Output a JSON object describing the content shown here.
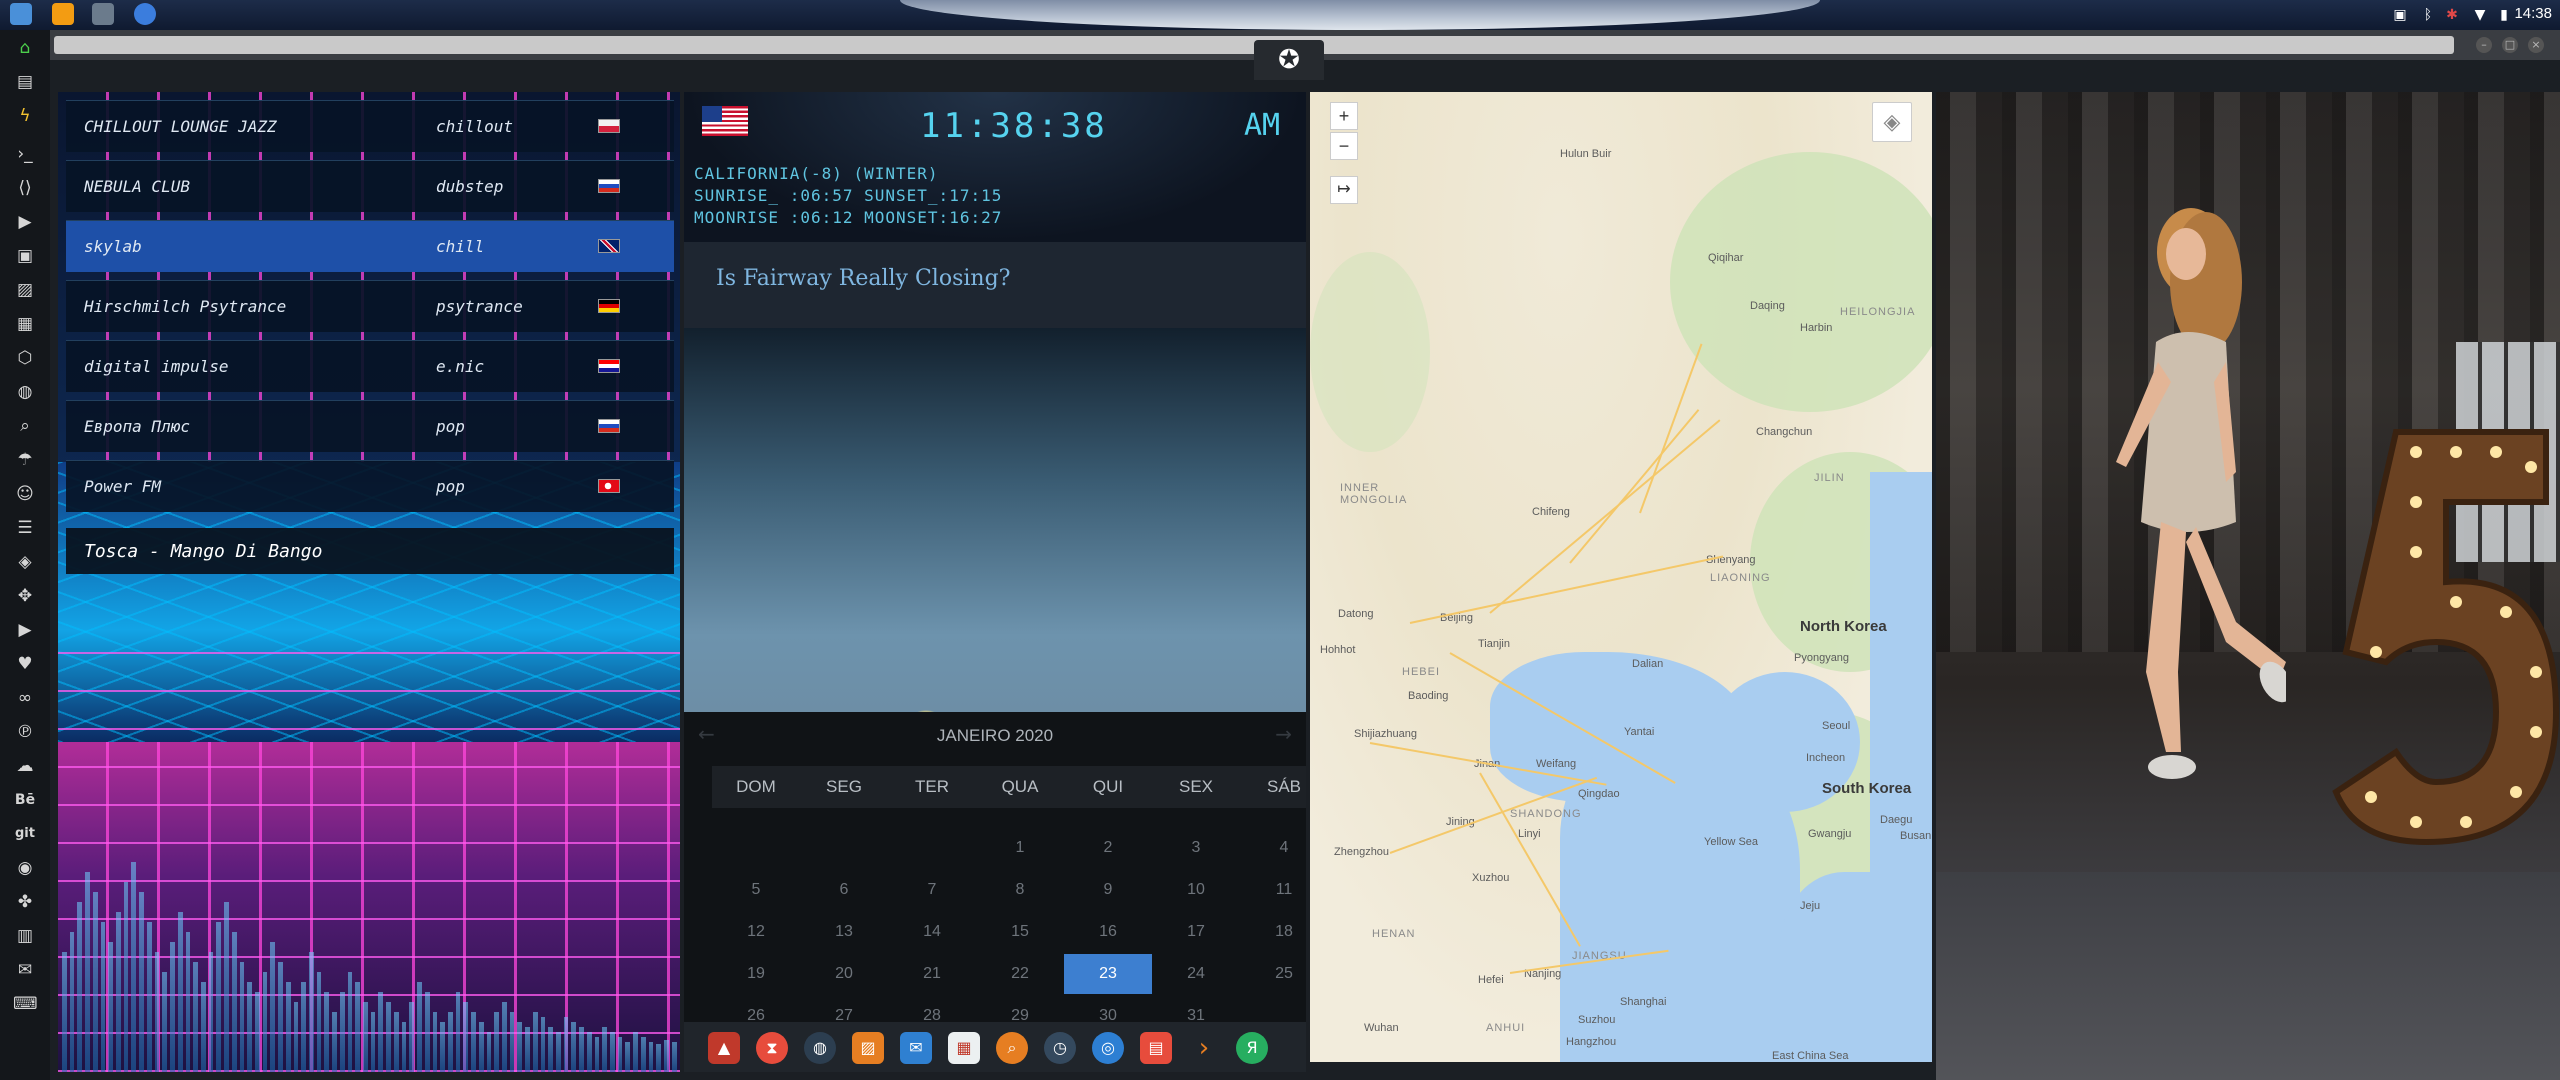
{
  "system": {
    "time": "14:38"
  },
  "radio": {
    "stations": [
      {
        "name": "CHILLOUT LOUNGE JAZZ",
        "genre": "chillout",
        "flag": "poland-flag"
      },
      {
        "name": "NEBULA CLUB",
        "genre": "dubstep",
        "flag": "russia-flag"
      },
      {
        "name": "skylab",
        "genre": "chill",
        "flag": "uk-flag"
      },
      {
        "name": "Hirschmilch Psytrance",
        "genre": "psytrance",
        "flag": "germany-flag"
      },
      {
        "name": "digital impulse",
        "genre": "e.nic",
        "flag": "croatia-flag"
      },
      {
        "name": "Европа Плюс",
        "genre": "pop",
        "flag": "russia-flag"
      },
      {
        "name": "Power FM",
        "genre": "pop",
        "flag": "turkey-flag"
      }
    ],
    "active_index": 2,
    "now_playing": "Tosca - Mango Di Bango"
  },
  "clock": {
    "time": "11:38:38",
    "ampm": "AM",
    "location": "CALIFORNIA(-8) (WINTER)",
    "sun": "SUNRISE_ :06:57 SUNSET_:17:15",
    "moon": "MOONRISE :06:12 MOONSET:16:27",
    "headline": "Is Fairway Really Closing?"
  },
  "calendar": {
    "month": "JANEIRO 2020",
    "weekdays": [
      "DOM",
      "SEG",
      "TER",
      "QUA",
      "QUI",
      "SEX",
      "SÁB"
    ],
    "weeks": [
      [
        "",
        "",
        "",
        "1",
        "2",
        "3",
        "4"
      ],
      [
        "5",
        "6",
        "7",
        "8",
        "9",
        "10",
        "11"
      ],
      [
        "12",
        "13",
        "14",
        "15",
        "16",
        "17",
        "18"
      ],
      [
        "19",
        "20",
        "21",
        "22",
        "23",
        "24",
        "25"
      ],
      [
        "26",
        "27",
        "28",
        "29",
        "30",
        "31",
        ""
      ]
    ],
    "today": "23"
  },
  "map": {
    "zoom_in": "+",
    "zoom_out": "−",
    "labels": {
      "north_korea": "North Korea",
      "south_korea": "South Korea",
      "inner_mongolia": "INNER\nMONGOLIA",
      "liaoning": "LIAONING",
      "jilin": "JILIN",
      "heilongjiang": "HEILONGJIA",
      "hebei": "HEBEI",
      "shandong": "SHANDONG",
      "henan": "HENAN",
      "jiangsu": "JIANGSU",
      "anhui": "ANHUI",
      "beijing": "Beijing",
      "tianjin": "Tianjin",
      "shenyang": "Shenyang",
      "dalian": "Dalian",
      "harbin": "Harbin",
      "changchun": "Changchun",
      "pyongyang": "Pyongyang",
      "seoul": "Seoul",
      "incheon": "Incheon",
      "daegu": "Daegu",
      "busan": "Busan",
      "gwangju": "Gwangju",
      "jeju": "Jeju",
      "qingdao": "Qingdao",
      "jinan": "Jinan",
      "yantai": "Yantai",
      "weifang": "Weifang",
      "shijiazhuang": "Shijiazhuang",
      "baoding": "Baoding",
      "zhengzhou": "Zhengzhou",
      "hefei": "Hefei",
      "nanjing": "Nanjing",
      "shanghai": "Shanghai",
      "suzhou": "Suzhou",
      "hangzhou": "Hangzhou",
      "wuhan": "Wuhan",
      "xuzhou": "Xuzhou",
      "linyi": "Linyi",
      "jining": "Jining",
      "hulun_buir": "Hulun Buir",
      "qiqihar": "Qiqihar",
      "daqing": "Daqing",
      "chifeng": "Chifeng",
      "datong": "Datong",
      "hohhot": "Hohhot",
      "yellow_sea": "Yellow Sea",
      "east_china_sea": "East China Sea"
    }
  }
}
